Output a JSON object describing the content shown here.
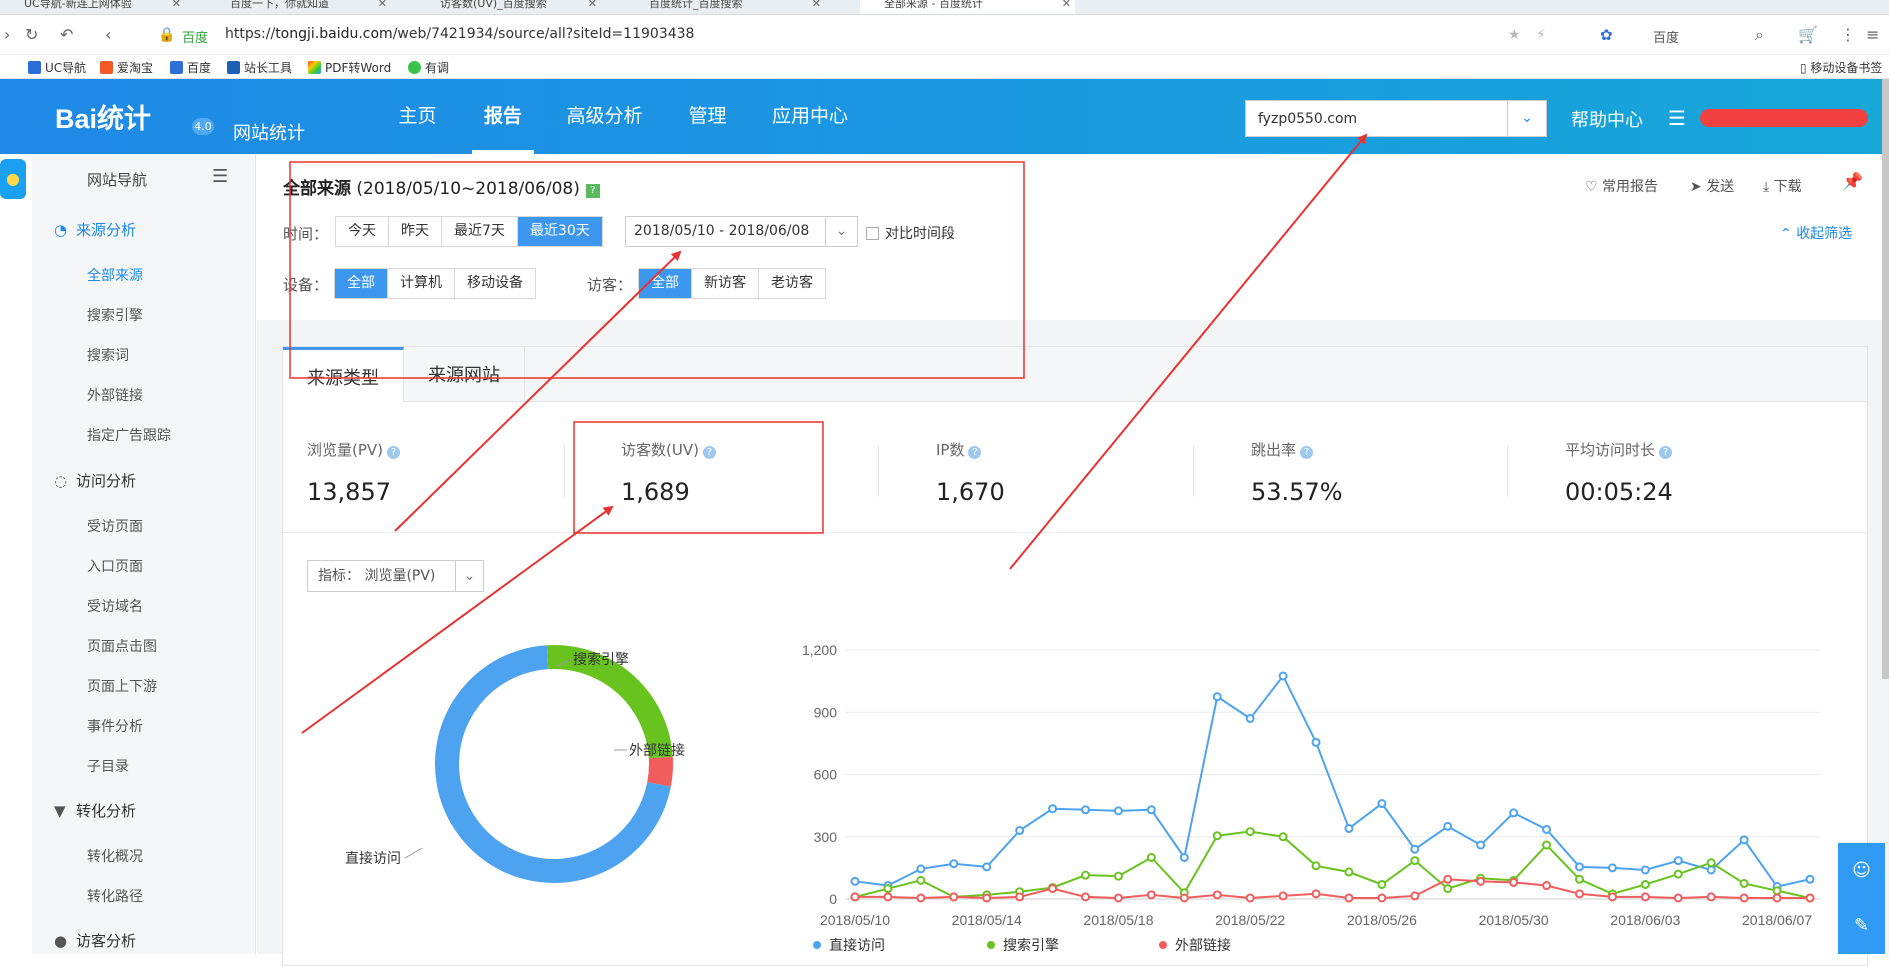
{
  "browser": {
    "tabs": [
      "UC导航-新连上网体验",
      "百度一下，你就知道",
      "访客数(UV)_百度搜索",
      "百度统计_百度搜索",
      "全部来源 - 百度统计"
    ],
    "url_prefix": "https://",
    "url_host": "tongji.baidu.com",
    "url_path": "/web/7421934/source/all?siteId=11903438",
    "site_badge": "百度",
    "search_engine": "百度",
    "bookmarks": [
      "UC导航",
      "爱淘宝",
      "百度",
      "站长工具",
      "PDF转Word",
      "有调"
    ],
    "mobile_bookmark": "移动设备书签"
  },
  "header": {
    "logo": "Bai统计",
    "version": "4.0",
    "product": "网站统计",
    "nav": [
      "主页",
      "报告",
      "高级分析",
      "管理",
      "应用中心"
    ],
    "active_nav": "报告",
    "site": "fyzp0550.com",
    "help": "帮助中心"
  },
  "sidebar": {
    "title": "网站导航",
    "sections": [
      {
        "label": "来源分析",
        "items": [
          "全部来源",
          "搜索引擎",
          "搜索词",
          "外部链接",
          "指定广告跟踪"
        ]
      },
      {
        "label": "访问分析",
        "items": [
          "受访页面",
          "入口页面",
          "受访域名",
          "页面点击图",
          "页面上下游",
          "事件分析",
          "子目录"
        ]
      },
      {
        "label": "转化分析",
        "items": [
          "转化概况",
          "转化路径"
        ]
      },
      {
        "label": "访客分析",
        "items": []
      }
    ],
    "selected": "全部来源"
  },
  "filter": {
    "title": "全部来源",
    "range": "(2018/05/10~2018/06/08)",
    "tools": [
      "常用报告",
      "发送",
      "下载"
    ],
    "time_label": "时间：",
    "time_options": [
      "今天",
      "昨天",
      "最近7天",
      "最近30天"
    ],
    "time_selected": "最近30天",
    "date_value": "2018/05/10 - 2018/06/08",
    "compare": "对比时间段",
    "collapse": "收起筛选",
    "device_label": "设备：",
    "device_options": [
      "全部",
      "计算机",
      "移动设备"
    ],
    "device_selected": "全部",
    "visitor_label": "访客：",
    "visitor_options": [
      "全部",
      "新访客",
      "老访客"
    ],
    "visitor_selected": "全部"
  },
  "tabs": [
    "来源类型",
    "来源网站"
  ],
  "metrics": [
    {
      "label": "浏览量(PV)",
      "value": "13,857"
    },
    {
      "label": "访客数(UV)",
      "value": "1,689"
    },
    {
      "label": "IP数",
      "value": "1,670"
    },
    {
      "label": "跳出率",
      "value": "53.57%"
    },
    {
      "label": "平均访问时长",
      "value": "00:05:24"
    }
  ],
  "metric_selector": {
    "label": "指标：",
    "value": "浏览量(PV)"
  },
  "colors": {
    "direct": "#4da3f0",
    "search": "#69c31f",
    "external": "#f15c5c",
    "accent": "#3d97ef",
    "annotation": "#e8322f"
  },
  "chart_data": [
    {
      "type": "pie",
      "donut": true,
      "labels": [
        "直接访问",
        "搜索引擎",
        "外部链接"
      ],
      "values": [
        71,
        25,
        4
      ]
    },
    {
      "type": "line",
      "x": [
        "2018/05/10",
        "2018/05/11",
        "2018/05/12",
        "2018/05/13",
        "2018/05/14",
        "2018/05/15",
        "2018/05/16",
        "2018/05/17",
        "2018/05/18",
        "2018/05/19",
        "2018/05/20",
        "2018/05/21",
        "2018/05/22",
        "2018/05/23",
        "2018/05/24",
        "2018/05/25",
        "2018/05/26",
        "2018/05/27",
        "2018/05/28",
        "2018/05/29",
        "2018/05/30",
        "2018/05/31",
        "2018/06/01",
        "2018/06/02",
        "2018/06/03",
        "2018/06/04",
        "2018/06/05",
        "2018/06/06",
        "2018/06/07",
        "2018/06/08"
      ],
      "xticks": [
        "2018/05/10",
        "2018/05/14",
        "2018/05/18",
        "2018/05/22",
        "2018/05/26",
        "2018/05/30",
        "2018/06/03",
        "2018/06/07"
      ],
      "ylim": [
        0,
        1200
      ],
      "yticks": [
        "0",
        "300",
        "600",
        "900",
        "1,200"
      ],
      "series": [
        {
          "name": "直接访问",
          "values": [
            85,
            65,
            145,
            170,
            155,
            330,
            435,
            430,
            425,
            430,
            200,
            975,
            870,
            1075,
            755,
            340,
            460,
            240,
            350,
            260,
            415,
            335,
            155,
            150,
            140,
            185,
            140,
            285,
            60,
            95
          ]
        },
        {
          "name": "搜索引擎",
          "values": [
            10,
            50,
            90,
            10,
            20,
            35,
            55,
            115,
            110,
            200,
            30,
            305,
            325,
            300,
            160,
            130,
            70,
            185,
            50,
            100,
            90,
            260,
            95,
            25,
            70,
            120,
            175,
            75,
            40,
            5
          ]
        },
        {
          "name": "外部链接",
          "values": [
            10,
            10,
            5,
            10,
            5,
            10,
            50,
            10,
            5,
            20,
            5,
            20,
            5,
            15,
            25,
            5,
            5,
            15,
            95,
            85,
            80,
            65,
            25,
            10,
            10,
            5,
            10,
            5,
            5,
            5
          ]
        }
      ]
    }
  ]
}
